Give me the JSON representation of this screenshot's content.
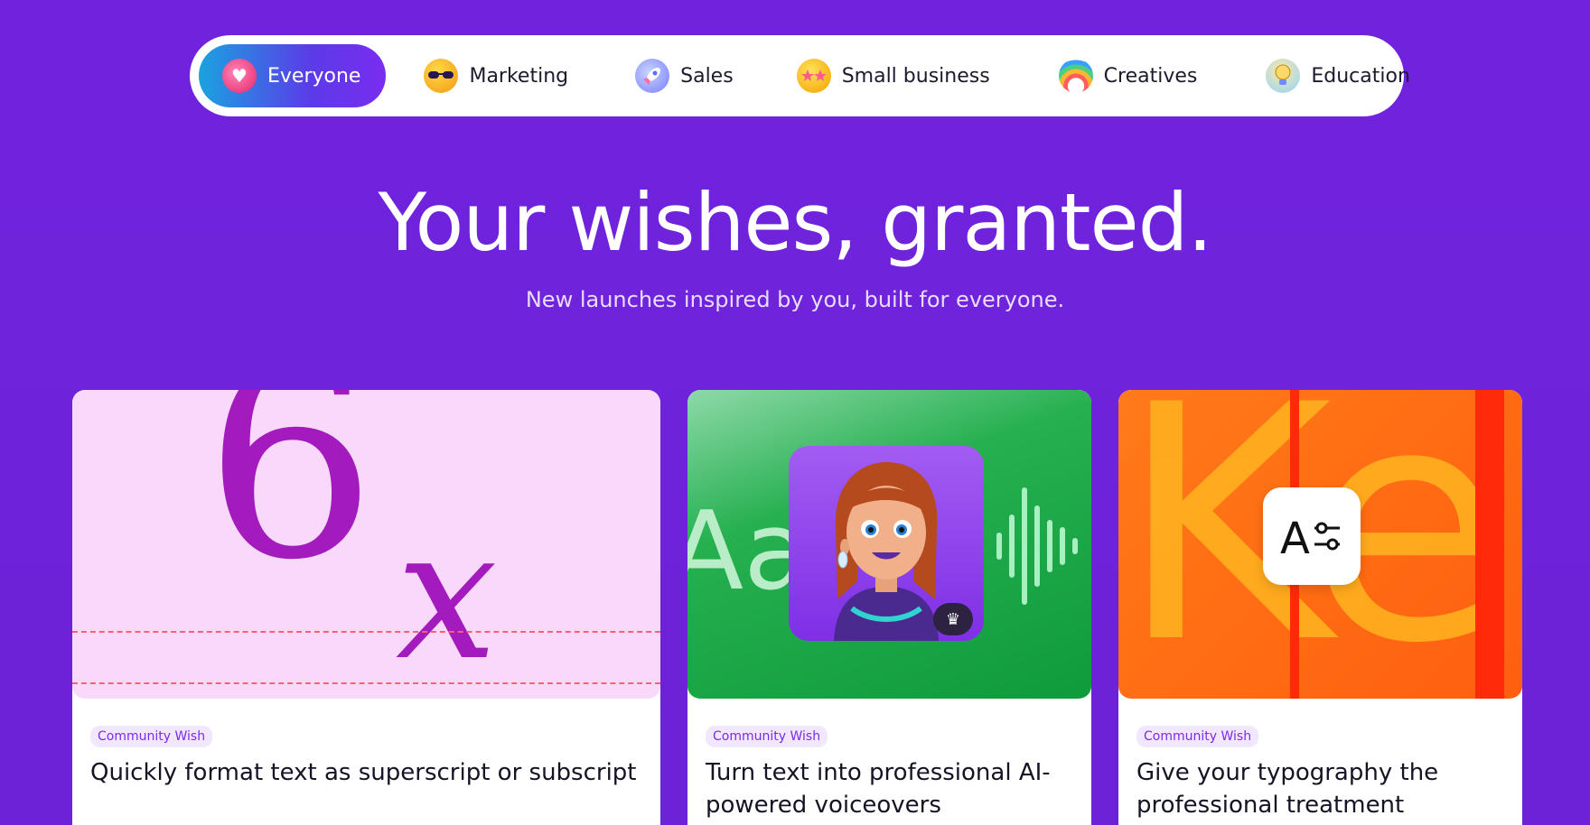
{
  "tabs": [
    {
      "label": "Everyone",
      "icon": "sparkling-heart-icon",
      "active": true
    },
    {
      "label": "Marketing",
      "icon": "sunglasses-face-icon",
      "active": false
    },
    {
      "label": "Sales",
      "icon": "rocket-icon",
      "active": false
    },
    {
      "label": "Small business",
      "icon": "star-struck-face-icon",
      "active": false
    },
    {
      "label": "Creatives",
      "icon": "rainbow-icon",
      "active": false
    },
    {
      "label": "Education",
      "icon": "lightbulb-icon",
      "active": false
    }
  ],
  "hero": {
    "title": "Your wishes, granted.",
    "subtitle": "New launches inspired by you, built for everyone."
  },
  "cards": [
    {
      "badge": "Community Wish",
      "title": "Quickly format text as superscript or subscript",
      "art": {
        "base": "6",
        "sub": "x"
      }
    },
    {
      "badge": "Community Wish",
      "title": "Turn text into professional AI-powered voiceovers",
      "art": {
        "text": "Aa"
      }
    },
    {
      "badge": "Community Wish",
      "title": "Give your typography the professional treatment",
      "art": {
        "text": "Ke",
        "icon_text": "A"
      }
    }
  ],
  "colors": {
    "background": "#7124dd",
    "active_tab_gradient_start": "#1aa3e0",
    "active_tab_gradient_end": "#7a2cf0",
    "badge_text": "#7d2ae8"
  }
}
